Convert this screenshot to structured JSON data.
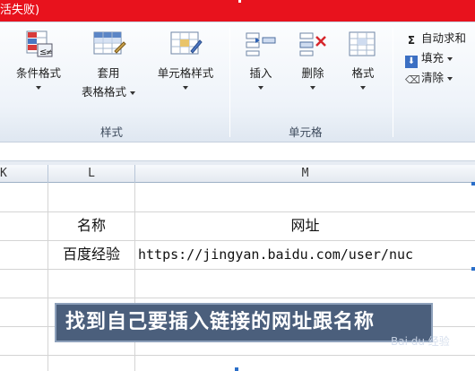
{
  "window": {
    "title_fragment": "活失败)"
  },
  "ribbon": {
    "styles_group": {
      "label": "样式",
      "buttons": [
        {
          "id": "conditional-formatting",
          "label": "条件格式",
          "icon": "conditional-format-icon"
        },
        {
          "id": "format-as-table",
          "label_line1": "套用",
          "label_line2": "表格格式",
          "icon": "table-format-icon"
        },
        {
          "id": "cell-styles",
          "label": "单元格样式",
          "icon": "cell-style-icon"
        }
      ]
    },
    "cells_group": {
      "label": "单元格",
      "buttons": [
        {
          "id": "insert",
          "label": "插入",
          "icon": "insert-cells-icon"
        },
        {
          "id": "delete",
          "label": "删除",
          "icon": "delete-cells-icon"
        },
        {
          "id": "format",
          "label": "格式",
          "icon": "format-cells-icon"
        }
      ]
    },
    "editing_group": {
      "buttons": [
        {
          "id": "autosum",
          "label": "自动求和",
          "icon": "sigma-icon"
        },
        {
          "id": "fill",
          "label": "填充",
          "icon": "fill-down-icon"
        },
        {
          "id": "clear",
          "label": "清除",
          "icon": "eraser-icon"
        }
      ]
    }
  },
  "sheet": {
    "columns": [
      "K",
      "L",
      "M"
    ],
    "rows": [
      {
        "L": "",
        "M": ""
      },
      {
        "L": "名称",
        "M": "网址"
      },
      {
        "L": "百度经验",
        "M": "https://jingyan.baidu.com/user/nuc"
      }
    ]
  },
  "caption": {
    "text": "找到自己要插入链接的网址跟名称"
  },
  "watermark": {
    "text": "Bai du 经验"
  }
}
